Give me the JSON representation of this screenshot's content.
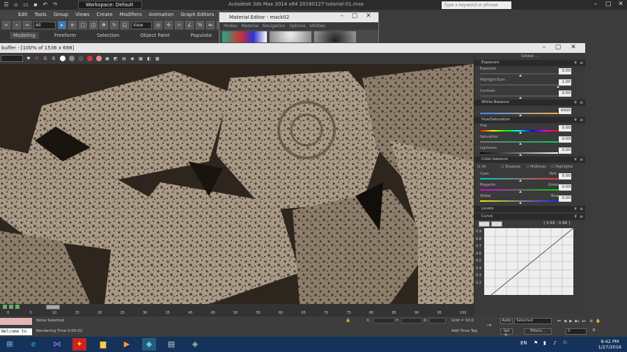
{
  "app": {
    "title": "Autodesk 3ds Max 2014 x64    20160127-tutorial-01.max",
    "workspace": "Workspace: Default",
    "search_placeholder": "Type a keyword or phrase"
  },
  "menu": [
    "Edit",
    "Tools",
    "Group",
    "Views",
    "Create",
    "Modifiers",
    "Animation",
    "Graph Editors"
  ],
  "toolbar": {
    "selection_filter": "All",
    "ref_coord": "View"
  },
  "ribbon_tabs": [
    "Modeling",
    "Freeform",
    "Selection",
    "Object Paint",
    "Populate"
  ],
  "material_editor": {
    "title": "Material Editor - mack02",
    "menus": [
      "Modes",
      "Material",
      "Navigation",
      "Options",
      "Utilities"
    ]
  },
  "framebuffer": {
    "title": "buffer - [100% of 1536 x 698]",
    "channels": [
      "R",
      "G",
      "B"
    ]
  },
  "panel": {
    "global_label": "Global ...",
    "sections": [
      {
        "title": "Exposure",
        "params": [
          {
            "label": "Exposure",
            "value": "0.00"
          },
          {
            "label": "Highlight Burn",
            "value": "1.00"
          },
          {
            "label": "Contrast",
            "value": "0.00"
          }
        ]
      },
      {
        "title": "White Balance",
        "params": [
          {
            "label": "",
            "value": "6500"
          }
        ]
      },
      {
        "title": "Hue/Saturation",
        "params": [
          {
            "label": "Hue",
            "value": "0.00"
          },
          {
            "label": "Saturation",
            "value": "0.00"
          },
          {
            "label": "Lightness",
            "value": "0.00"
          }
        ]
      },
      {
        "title": "Color balance",
        "checks": [
          "All",
          "Shadows",
          "Midtones",
          "Highlights"
        ],
        "params": [
          {
            "label": "Cyan",
            "right": "Red",
            "value": "0.00"
          },
          {
            "label": "Magenta",
            "right": "Green",
            "value": "0.00"
          },
          {
            "label": "Yellow",
            "right": "Blue",
            "value": "0.00"
          }
        ]
      },
      {
        "title": "Levels"
      },
      {
        "title": "Curve",
        "readout": "[ 0.93 ; 0.88 ]"
      }
    ],
    "curve_ticks": [
      "0.9",
      "0.8",
      "0.7",
      "0.6",
      "0.5",
      "0.4",
      "0.3",
      "0.2"
    ]
  },
  "timeline": {
    "ticks": [
      "0",
      "5",
      "10",
      "15",
      "20",
      "25",
      "30",
      "35",
      "40",
      "45",
      "50",
      "55",
      "60",
      "65",
      "70",
      "75",
      "80",
      "85",
      "90",
      "95",
      "100"
    ]
  },
  "status": {
    "selection": "None Selected",
    "render_time": "Rendering Time 0:00:02",
    "x_label": "X:",
    "y_label": "Y:",
    "z_label": "Z:",
    "grid": "Grid = 10.0",
    "add_time_tag": "Add Time Tag",
    "auto": "Auto",
    "set_k": "Set K.",
    "selected": "Selected",
    "filters": "Filters...",
    "frame": "0"
  },
  "maxscript": "Welcome to",
  "taskbar": {
    "lang": "EN",
    "time": "9:42 PM",
    "date": "1/27/2016"
  }
}
